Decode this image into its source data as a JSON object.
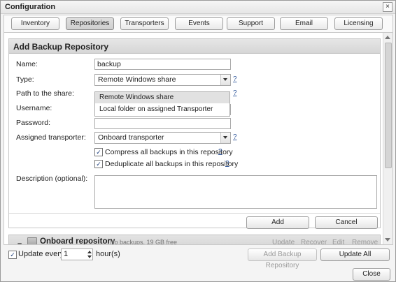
{
  "window": {
    "title": "Configuration",
    "close_glyph": "×"
  },
  "tabs": [
    {
      "label": "Inventory"
    },
    {
      "label": "Repositories"
    },
    {
      "label": "Transporters"
    },
    {
      "label": "Events"
    },
    {
      "label": "Support"
    },
    {
      "label": "Email"
    },
    {
      "label": "Licensing"
    }
  ],
  "active_tab": "Repositories",
  "form": {
    "header": "Add Backup Repository",
    "name_label": "Name:",
    "name_value": "backup",
    "type_label": "Type:",
    "type_value": "Remote Windows share",
    "type_options": [
      "Remote Windows share",
      "Local folder on assigned Transporter"
    ],
    "path_label": "Path to the share:",
    "username_label": "Username:",
    "password_label": "Password:",
    "transporter_label": "Assigned transporter:",
    "transporter_value": "Onboard transporter",
    "compress_label": "Compress all backups in this repository",
    "compress_checked": true,
    "dedup_label": "Deduplicate all backups in this repository",
    "dedup_checked": true,
    "description_label": "Description (optional):",
    "help": "?",
    "add_button": "Add",
    "cancel_button": "Cancel"
  },
  "repository_row": {
    "collapse_glyph": "–",
    "name": "Onboard repository",
    "meta": "No backups, 19 GB free",
    "actions": [
      "Update",
      "Recover",
      "Edit",
      "Remove"
    ]
  },
  "footer": {
    "update_checked": true,
    "update_label": "Update every",
    "interval_value": "1",
    "interval_unit": "hour(s)",
    "add_repo_button": "Add Backup Repository",
    "update_all_button": "Update All",
    "close_button": "Close"
  },
  "colors": {
    "help_link": "#3a5fa0",
    "panel_header": "#dcdcdc",
    "check": "#1b3d7a"
  },
  "icons": [
    "close-icon",
    "dropdown-arrow-icon",
    "checkmark-icon",
    "drive-icon",
    "spinner-up-icon",
    "spinner-down-icon"
  ]
}
